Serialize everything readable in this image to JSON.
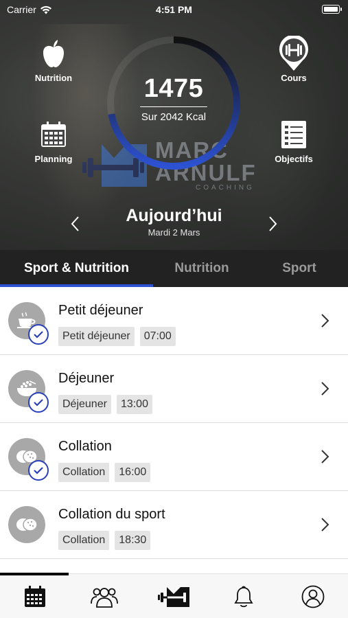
{
  "status": {
    "carrier": "Carrier",
    "time": "4:51 PM"
  },
  "shortcuts": {
    "nutrition": {
      "label": "Nutrition",
      "icon": "apple-icon"
    },
    "planning": {
      "label": "Planning",
      "icon": "calendar-icon"
    },
    "cours": {
      "label": "Cours",
      "icon": "dumbbell-pin-icon"
    },
    "objectifs": {
      "label": "Objectifs",
      "icon": "checklist-icon"
    }
  },
  "calories": {
    "value": "1475",
    "goal_text": "Sur 2042 Kcal",
    "progress_fraction": 0.722,
    "ring_color": "#2d52d2"
  },
  "brand": {
    "line1": "MARC",
    "line2": "ARNULF",
    "line3": "COACHING"
  },
  "day": {
    "title": "Aujourd’hui",
    "date": "Mardi 2 Mars"
  },
  "tabs": [
    {
      "label": "Sport & Nutrition",
      "active": true
    },
    {
      "label": "Nutrition",
      "active": false
    },
    {
      "label": "Sport",
      "active": false
    }
  ],
  "meals": [
    {
      "title": "Petit déjeuner",
      "tag": "Petit déjeuner",
      "time": "07:00",
      "icon": "coffee-cup-icon",
      "done": true
    },
    {
      "title": "Déjeuner",
      "tag": "Déjeuner",
      "time": "13:00",
      "icon": "bowl-icon",
      "done": true
    },
    {
      "title": "Collation",
      "tag": "Collation",
      "time": "16:00",
      "icon": "biscuits-icon",
      "done": true
    },
    {
      "title": "Collation du sport",
      "tag": "Collation",
      "time": "18:30",
      "icon": "biscuits-icon",
      "done": false
    }
  ],
  "bottom_nav": [
    "calendar-icon",
    "group-icon",
    "brand-logo-icon",
    "bell-icon",
    "profile-icon"
  ],
  "colors": {
    "accent": "#2d52d2",
    "tab_bar": "#222222",
    "avatar": "#a8a8a8"
  }
}
